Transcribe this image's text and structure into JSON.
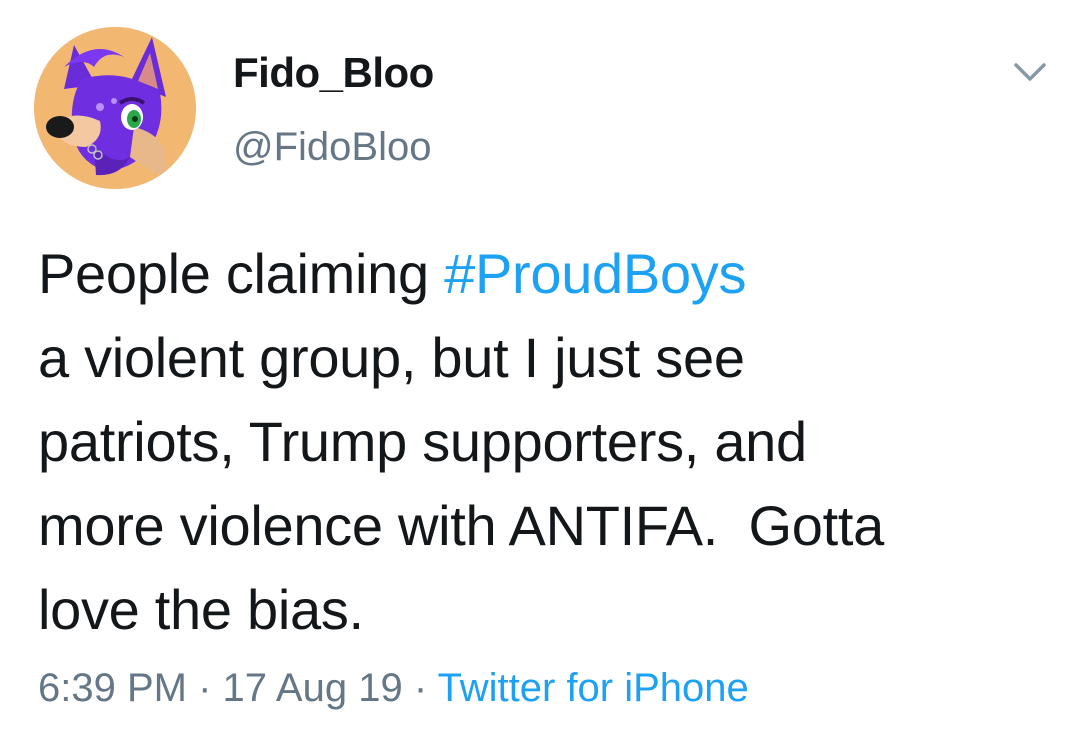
{
  "tweet": {
    "display_name": "Fido_Bloo",
    "handle": "@FidoBloo",
    "text_lines": {
      "line1_prefix": "People claiming ",
      "line1_hashtag": "#ProudBoys",
      "line2": "a violent group, but I just see",
      "line3": "patriots, Trump supporters, and",
      "line4": "more violence with ANTIFA.  Gotta",
      "line5": "love the bias."
    },
    "time": "6:39 PM",
    "sep1": " · ",
    "date": "17 Aug 19",
    "sep2": " · ",
    "source": "Twitter for iPhone"
  },
  "colors": {
    "text": "#14171a",
    "secondary": "#657786",
    "link": "#1da1f2",
    "background": "#ffffff"
  },
  "icons": {
    "avatar": "fox-character-avatar",
    "menu": "chevron-down-icon"
  }
}
